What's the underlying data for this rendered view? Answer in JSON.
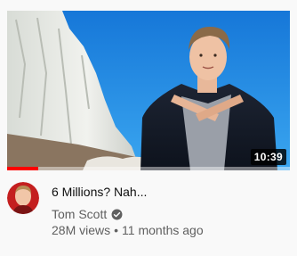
{
  "video": {
    "title": "6 Millions? Nah...",
    "duration": "10:39",
    "watch_progress": 0.11,
    "channel": {
      "name": "Tom Scott",
      "verified": true
    },
    "views": "28M views",
    "separator": "•",
    "age": "11 months ago"
  },
  "colors": {
    "progress": "#ff0000",
    "title_text": "#0f0f0f",
    "meta_text": "#606060",
    "sky": "#1a8fe0"
  },
  "icons": {
    "verified": "check-circle-icon"
  }
}
